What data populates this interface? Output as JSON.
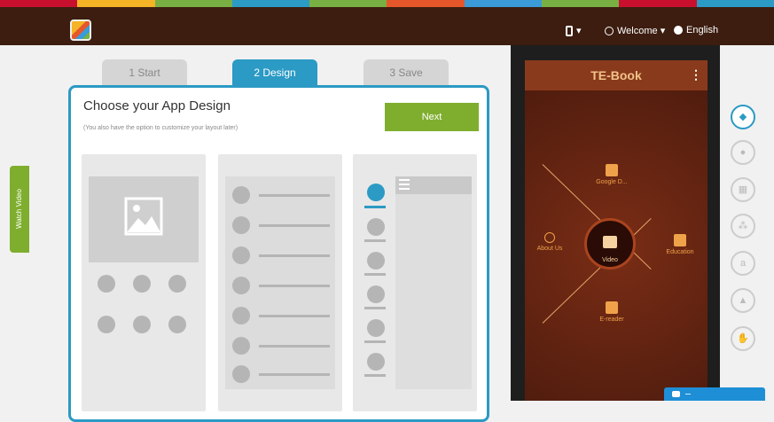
{
  "colors": {
    "strip": [
      "#c8102e",
      "#f4b425",
      "#78b043",
      "#2b9ac4",
      "#78b043",
      "#e6562b",
      "#3a9bd8",
      "#78b043",
      "#c8102e",
      "#2b9ac4"
    ],
    "accent": "#2b9ac4",
    "green": "#7fae2e",
    "topbar": "#3c1d10"
  },
  "header": {
    "logo_icon": "app-logo-icon",
    "device_icon": "mobile-device-icon",
    "device_label": "▾",
    "welcome_icon": "user-circle-icon",
    "welcome_label": "Welcome ▾",
    "language_icon": "globe-icon",
    "language_label": "English"
  },
  "steps": [
    {
      "label": "1 Start"
    },
    {
      "label": "2 Design"
    },
    {
      "label": "3 Save"
    }
  ],
  "design": {
    "title": "Choose your App Design",
    "subtitle": "(You also have the option to customize your layout later)",
    "next_label": "Next"
  },
  "watch_video": {
    "label": "Watch Video",
    "icon": "help-circle-icon"
  },
  "preview": {
    "app_title": "TE-Book",
    "menu_icon": "kebab-menu-icon",
    "items": [
      {
        "label": "Google D...",
        "icon": "book-icon"
      },
      {
        "label": "About Us",
        "icon": "person-icon"
      },
      {
        "label": "Education",
        "icon": "graduation-cap-icon"
      },
      {
        "label": "E-reader",
        "icon": "ebook-icon"
      }
    ],
    "center_label": "Video",
    "center_icon": "video-camera-icon"
  },
  "platforms": [
    {
      "name": "android",
      "icon": "android-icon",
      "selected": true
    },
    {
      "name": "apple",
      "icon": "apple-icon"
    },
    {
      "name": "windows",
      "icon": "windows-icon"
    },
    {
      "name": "blackberry",
      "icon": "blackberry-icon"
    },
    {
      "name": "amazon",
      "icon": "amazon-icon"
    },
    {
      "name": "google-drive",
      "icon": "google-play-icon"
    },
    {
      "name": "kindle",
      "icon": "hand-icon"
    }
  ],
  "chat": {
    "icon": "chat-icon"
  }
}
